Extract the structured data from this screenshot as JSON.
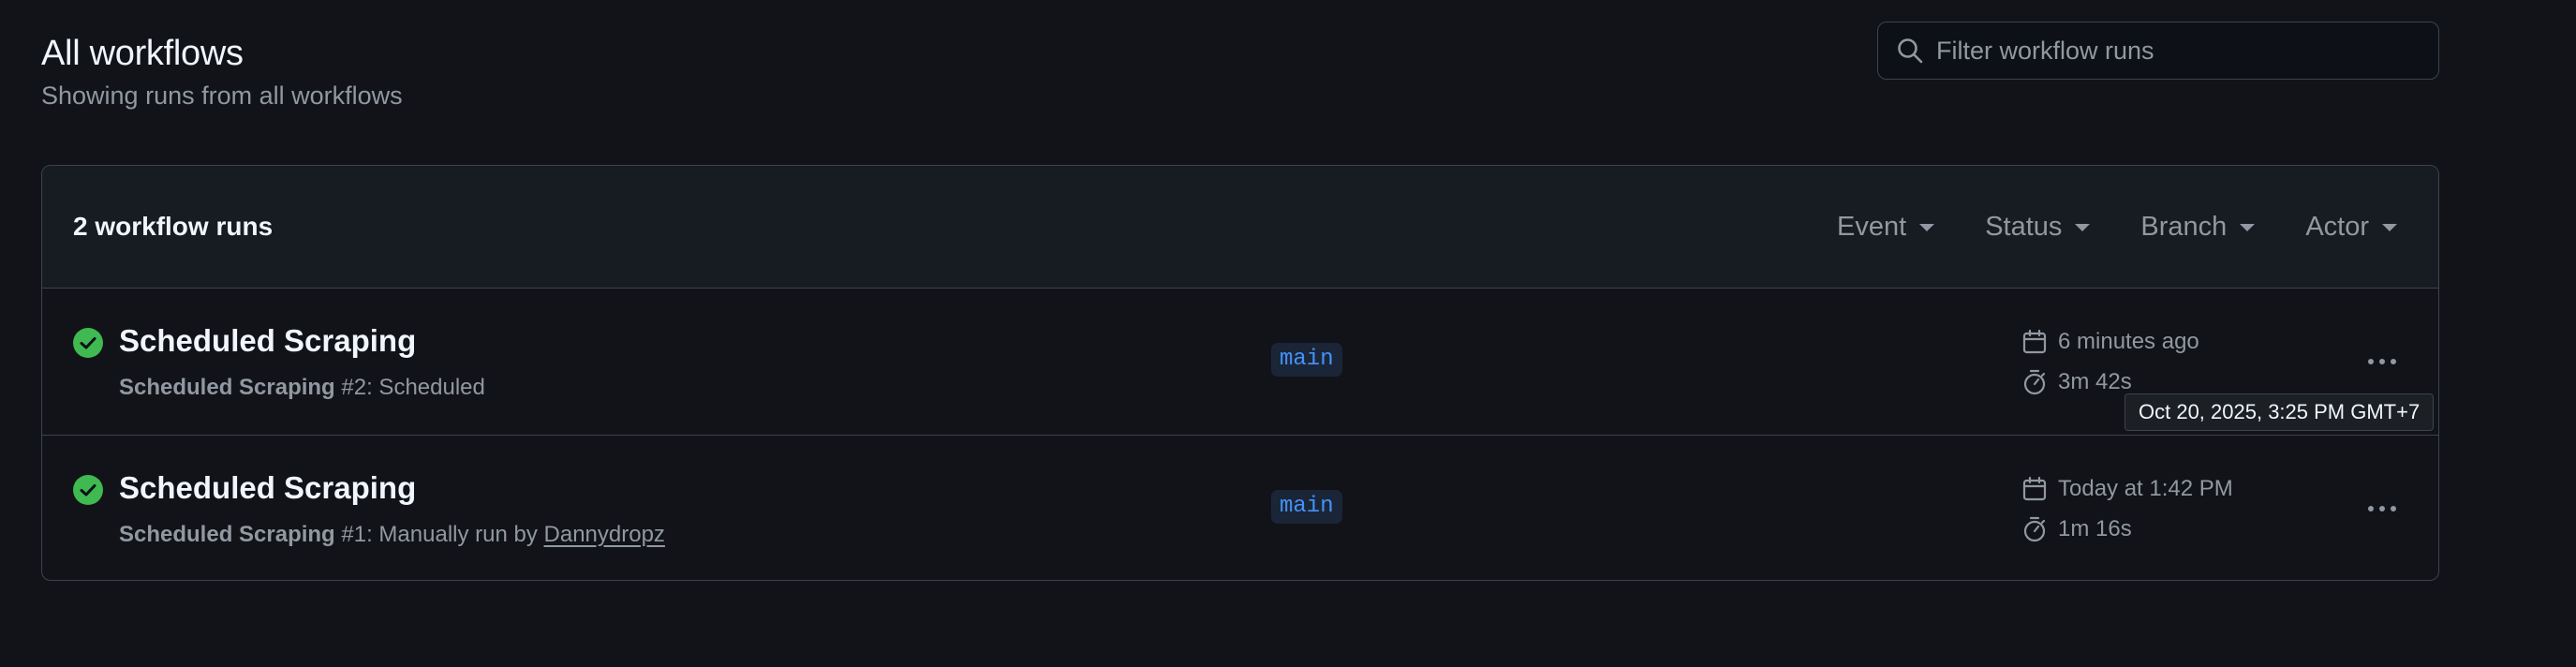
{
  "header": {
    "title": "All workflows",
    "subtitle": "Showing runs from all workflows"
  },
  "search": {
    "placeholder": "Filter workflow runs",
    "icon": "search-icon"
  },
  "runs_panel": {
    "count_label": "2 workflow runs",
    "filters": [
      "Event",
      "Status",
      "Branch",
      "Actor"
    ]
  },
  "runs": [
    {
      "status": "success",
      "title": "Scheduled Scraping",
      "workflow": "Scheduled Scraping",
      "run_number": "#2",
      "trigger": ": Scheduled",
      "actor": "",
      "branch": "main",
      "date": "6 minutes ago",
      "duration": "3m 42s"
    },
    {
      "status": "success",
      "title": "Scheduled Scraping",
      "workflow": "Scheduled Scraping",
      "run_number": "#1",
      "trigger": ": Manually run by ",
      "actor": "Dannydropz",
      "branch": "main",
      "date": "Today at 1:42 PM",
      "duration": "1m 16s"
    }
  ],
  "tooltip": {
    "text": "Oct 20, 2025, 3:25 PM GMT+7"
  },
  "colors": {
    "background": "#111318",
    "success": "#3fb950",
    "branch_text": "#4493f8",
    "border": "#3d444d"
  }
}
